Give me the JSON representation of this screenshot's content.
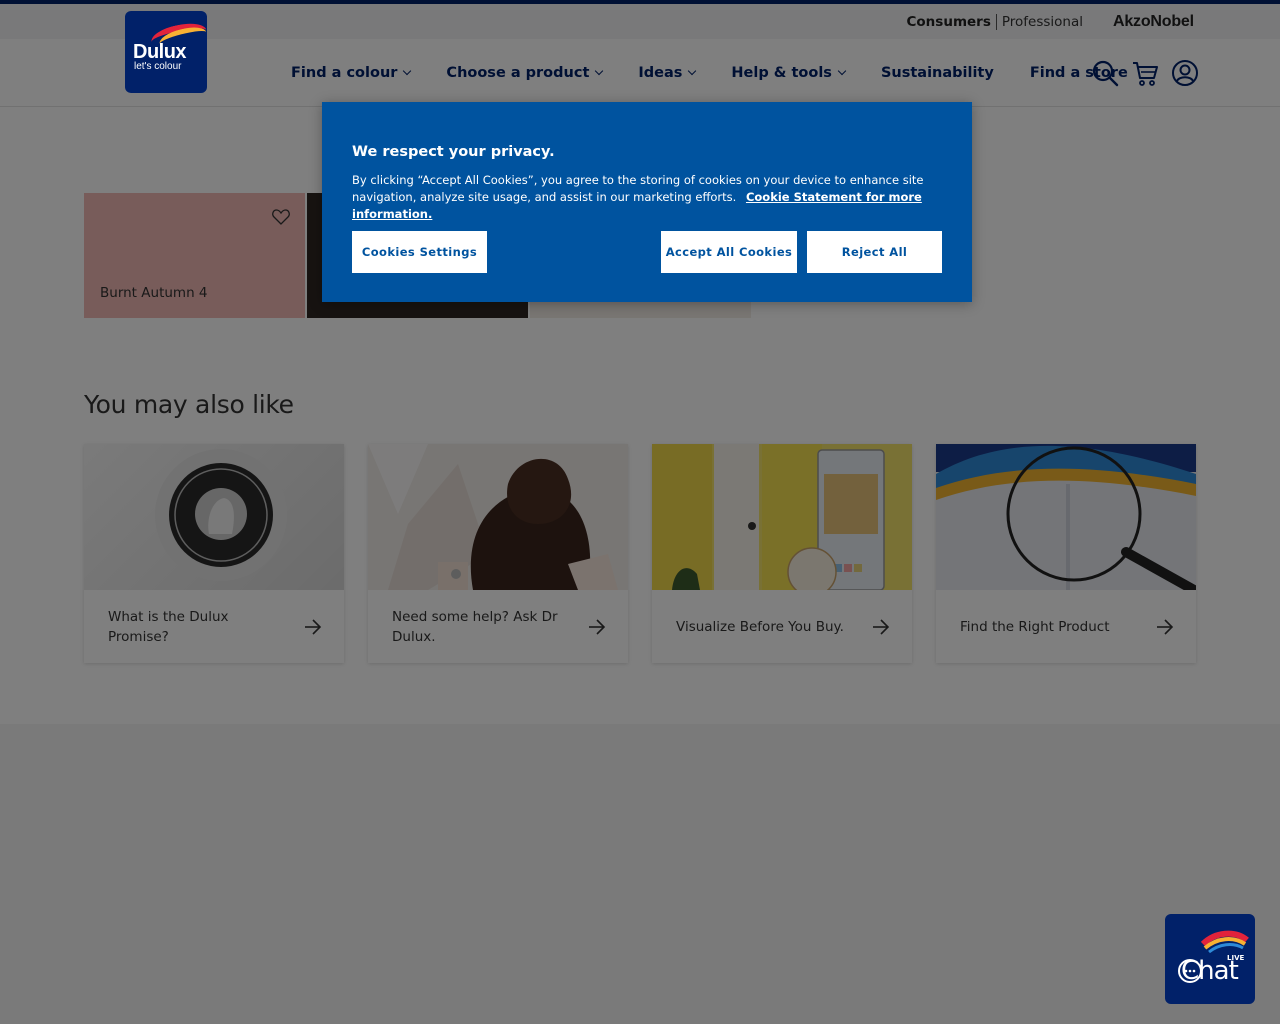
{
  "utility": {
    "consumers": "Consumers",
    "professional": "Professional",
    "akzonobel": "AkzoNobel"
  },
  "logo": {
    "brand": "Dulux",
    "tagline": "let's colour"
  },
  "nav": {
    "items": [
      {
        "label": "Find a colour"
      },
      {
        "label": "Choose a product"
      },
      {
        "label": "Ideas"
      },
      {
        "label": "Help & tools"
      },
      {
        "label": "Sustainability"
      },
      {
        "label": "Find a store"
      }
    ]
  },
  "swatches": [
    {
      "name": "Burnt Autumn 4",
      "color": "#f0b8b4"
    },
    {
      "name": "",
      "color": "#2e2623"
    },
    {
      "name": "",
      "color": "#f2ede7"
    }
  ],
  "section": {
    "title": "You may also like"
  },
  "cards": [
    {
      "title": "What is the Dulux Promise?"
    },
    {
      "title": "Need some help? Ask Dr Dulux."
    },
    {
      "title": "Visualize Before You Buy."
    },
    {
      "title": "Find the Right Product"
    }
  ],
  "cookie": {
    "title": "We respect your privacy.",
    "body": "By clicking “Accept All Cookies”, you agree to the storing of cookies on your device to enhance site navigation, analyze site usage, and assist in our marketing efforts.",
    "link": "Cookie Statement for more information.",
    "settings": "Cookies Settings",
    "accept": "Accept All Cookies",
    "reject": "Reject All",
    "bg_color": "#00539f"
  },
  "chat": {
    "word": "Chat",
    "live": "LIVE"
  },
  "colors": {
    "brand_navy": "#012169"
  }
}
